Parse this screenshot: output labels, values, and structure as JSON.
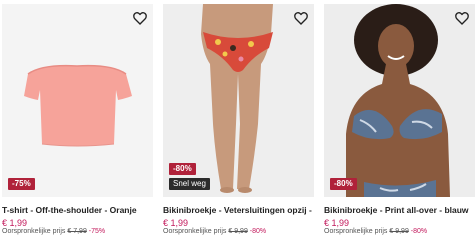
{
  "products": [
    {
      "title": "T-shirt - Off-the-shoulder - Oranje",
      "price": "€ 1,99",
      "original_label": "Oorspronkelijke prijs",
      "original_price": "€ 7,99",
      "original_discount": "-75%",
      "badge": "-75%",
      "tag": ""
    },
    {
      "title": "Bikinibroekje - Vetersluitingen opzij - Li...",
      "price": "€ 1,99",
      "original_label": "Oorspronkelijke prijs",
      "original_price": "€ 9,99",
      "original_discount": "-80%",
      "badge": "-80%",
      "tag": "Snel weg"
    },
    {
      "title": "Bikinibroekje - Print all-over - blauw",
      "price": "€ 1,99",
      "original_label": "Oorspronkelijke prijs",
      "original_price": "€ 9,99",
      "original_discount": "-80%",
      "badge": "-80%",
      "tag": ""
    }
  ],
  "colors": {
    "price": "#c2185b",
    "badge": "#b0223a",
    "tag": "#2b2b2b",
    "image_bg": "#f1f1f1"
  },
  "icons": {
    "wishlist": "heart-outline-icon"
  }
}
